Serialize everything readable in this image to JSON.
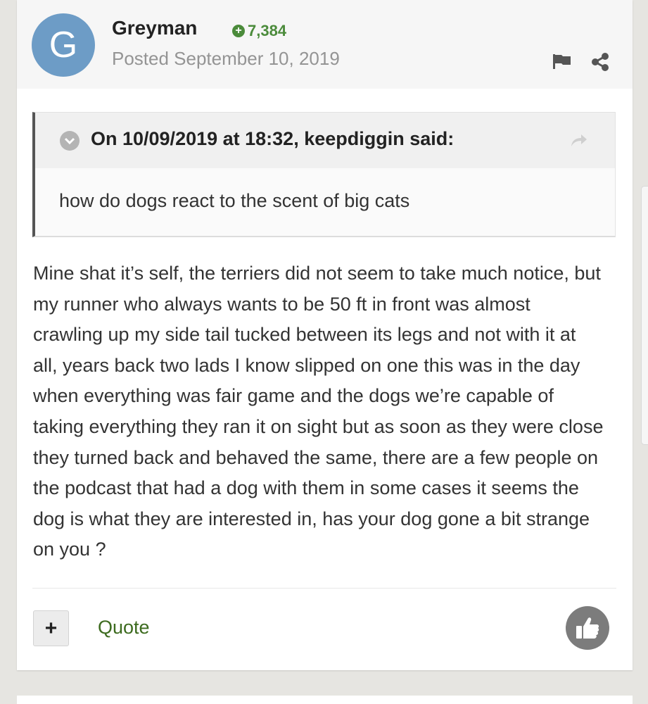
{
  "post": {
    "author": {
      "name": "Greyman",
      "avatar_letter": "G",
      "avatar_color": "#6d9cc6",
      "reputation": "7,384",
      "reputation_color": "#4b8b3b",
      "posted": "Posted September 10, 2019"
    },
    "icons": {
      "report": "flag-icon",
      "share": "share-icon",
      "quote_toggle": "chevron-down-icon",
      "quote_jump": "arrow-forward-icon",
      "react": "thumbs-up-icon"
    },
    "quote": {
      "citation": "On 10/09/2019 at 18:32, keepdiggin said:",
      "body": "how do dogs react to the scent of big cats"
    },
    "content_lines": [
      "Mine shat it’s self, the terriers did not seem to take much notice, but",
      "my runner who always wants to be 50 ft in front was almost",
      "crawling up my side tail tucked between its legs and not with it at",
      "all, years back two lads I know slipped on one this was in the day",
      "when everything was fair game and the dogs we’re capable of",
      "taking everything they ran it on sight but as soon as they were close",
      "they turned back and behaved the same, there are a few people on",
      "the podcast that had a dog with them in some cases it seems the",
      "dog is what they are interested in, has your dog gone a bit strange",
      "on you ?"
    ],
    "actions": {
      "multiquote_label": "+",
      "quote_label": "Quote"
    }
  }
}
